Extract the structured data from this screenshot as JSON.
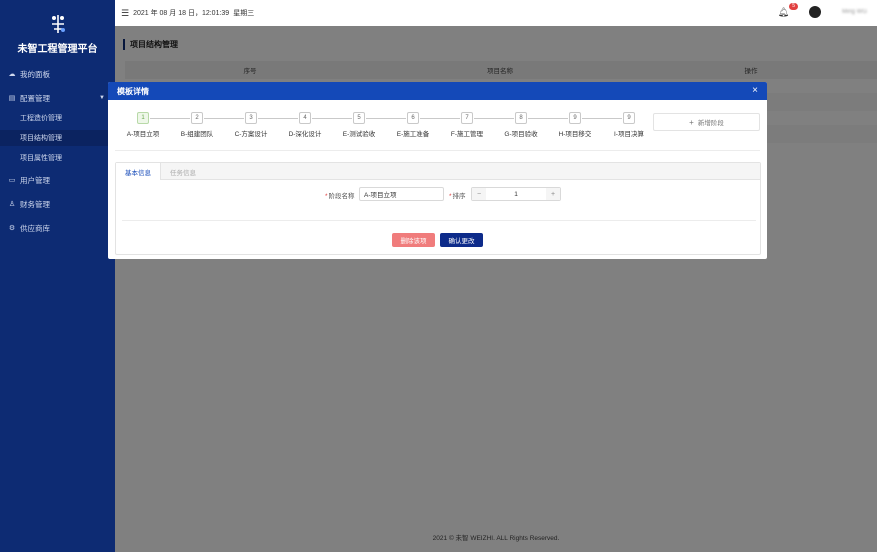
{
  "sidebar": {
    "brand": "未智工程管理平台",
    "items": [
      {
        "label": "我的面板",
        "icon": "cloud-icon"
      },
      {
        "label": "配置管理",
        "icon": "document-icon"
      },
      {
        "label": "用户管理",
        "icon": "folder-icon"
      },
      {
        "label": "财务管理",
        "icon": "users-icon"
      },
      {
        "label": "供应商库",
        "icon": "gear-icon"
      }
    ],
    "sub_items": [
      {
        "label": "工程造价管理"
      },
      {
        "label": "项目结构管理"
      },
      {
        "label": "项目属性管理"
      }
    ]
  },
  "header": {
    "datetime": "2021 年 08 月 18 日，12:01:39",
    "weekday": "星期三",
    "badge": "5",
    "username": "Ming WG"
  },
  "page": {
    "title": "项目结构管理",
    "columns": [
      "序号",
      "项目名称",
      "操作"
    ]
  },
  "modal": {
    "title": "模板详情",
    "close": "×",
    "add_stage": "新增阶段",
    "steps": [
      {
        "num": "1",
        "label": "A-项目立项"
      },
      {
        "num": "2",
        "label": "B-组建团队"
      },
      {
        "num": "3",
        "label": "C-方案设计"
      },
      {
        "num": "4",
        "label": "D-深化设计"
      },
      {
        "num": "5",
        "label": "E-测试验收"
      },
      {
        "num": "6",
        "label": "E-施工准备"
      },
      {
        "num": "7",
        "label": "F-施工管理"
      },
      {
        "num": "8",
        "label": "G-项目验收"
      },
      {
        "num": "9",
        "label": "H-项目移交"
      },
      {
        "num": "9",
        "label": "I-项目决算"
      }
    ],
    "tabs": [
      "基本信息",
      "任务信息"
    ],
    "form": {
      "stage_name_label": "阶段名称",
      "stage_name_value": "A-项目立项",
      "order_label": "排序",
      "order_value": "1",
      "minus": "−",
      "plus": "+"
    },
    "delete_label": "删除该项",
    "confirm_label": "确认更改"
  },
  "footer": "2021 © 未智 WEIZHI. ALL Rights Reserved.",
  "colors": {
    "sidebar": "#0d2b73",
    "modal_header": "#1449b8",
    "danger": "#f07c7c",
    "primary": "#0d2b8a"
  }
}
